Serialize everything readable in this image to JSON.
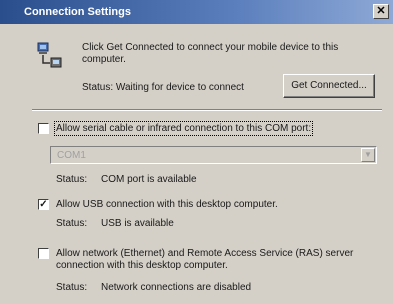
{
  "window": {
    "title": "Connection Settings",
    "close_glyph": "✕"
  },
  "intro": {
    "text": "Click Get Connected to connect your mobile device to this computer.",
    "status_label": "Status:",
    "status_value": "Waiting for device to connect",
    "button_label": "Get Connected..."
  },
  "com_port": {
    "checked": false,
    "label": "Allow serial cable or infrared connection to this COM port:",
    "selected_port": "COM1",
    "status_label": "Status:",
    "status_value": "COM port is available"
  },
  "usb": {
    "checked": true,
    "label": "Allow USB connection with this desktop computer.",
    "status_label": "Status:",
    "status_value": "USB is available"
  },
  "network": {
    "checked": false,
    "label": "Allow network (Ethernet) and Remote Access Service (RAS) server connection with this desktop computer.",
    "status_label": "Status:",
    "status_value": "Network connections are disabled"
  },
  "icons": {
    "connection": "connection-device-icon",
    "dropdown": "chevron-down-icon"
  }
}
